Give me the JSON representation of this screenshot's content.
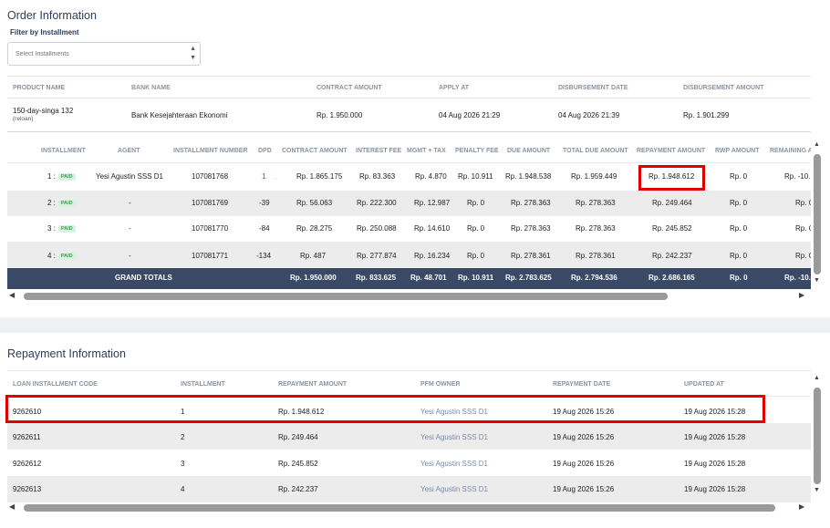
{
  "order": {
    "title": "Order Information",
    "filter_label": "Filter by Installment",
    "select_placeholder": "Select Installments",
    "headers": {
      "product_name": "PRODUCT NAME",
      "bank_name": "BANK NAME",
      "contract_amount": "CONTRACT AMOUNT",
      "apply_at": "APPLY AT",
      "disbursement_date": "DISBURSEMENT DATE",
      "disbursement_amount": "DISBURSEMENT AMOUNT"
    },
    "row": {
      "product_name": "150-day-singa 132",
      "product_sub": "(reloan)",
      "bank_name": "Bank Kesejahteraan Ekonomi",
      "contract_amount": "Rp. 1.950.000",
      "apply_at": "04 Aug 2026 21:29",
      "disbursement_date": "04 Aug 2026 21:39",
      "disbursement_amount": "Rp. 1.901.299"
    }
  },
  "installments": {
    "headers": {
      "installment": "INSTALLMENT",
      "agent": "AGENT",
      "installment_number": "INSTALLMENT NUMBER",
      "dpd": "DPD",
      "contract_amount": "CONTRACT AMOUNT",
      "interest_fee": "INTEREST FEE",
      "mgmt_tax": "MGMT + TAX",
      "penalty_fee": "PENALTY FEE",
      "due_amount": "DUE AMOUNT",
      "total_due_amount": "TOTAL DUE AMOUNT",
      "repayment_amount": "REPAYMENT AMOUNT",
      "rwp_amount": "RWP AMOUNT",
      "remaining": "REMAINING A"
    },
    "paid_label": "PAID",
    "rows": [
      {
        "installment": "1 :",
        "agent": "Yesi Agustin SSS D1",
        "number": "107081768",
        "dpd": "1",
        "contract": "Rp. 1.865.175",
        "interest": "Rp. 83.363",
        "mgmt": "Rp. 4.870",
        "penalty": "Rp. 10.911",
        "due": "Rp. 1.948.538",
        "total_due": "Rp. 1.959.449",
        "repayment": "Rp. 1.948.612",
        "rwp": "Rp. 0",
        "remaining": "Rp. -10."
      },
      {
        "installment": "2 :",
        "agent": "-",
        "number": "107081769",
        "dpd": "-39",
        "contract": "Rp. 56.063",
        "interest": "Rp. 222.300",
        "mgmt": "Rp. 12.987",
        "penalty": "Rp. 0",
        "due": "Rp. 278.363",
        "total_due": "Rp. 278.363",
        "repayment": "Rp. 249.464",
        "rwp": "Rp. 0",
        "remaining": "Rp. C"
      },
      {
        "installment": "3 :",
        "agent": "-",
        "number": "107081770",
        "dpd": "-84",
        "contract": "Rp. 28.275",
        "interest": "Rp. 250.088",
        "mgmt": "Rp. 14.610",
        "penalty": "Rp. 0",
        "due": "Rp. 278.363",
        "total_due": "Rp. 278.363",
        "repayment": "Rp. 245.852",
        "rwp": "Rp. 0",
        "remaining": "Rp. C"
      },
      {
        "installment": "4 :",
        "agent": "-",
        "number": "107081771",
        "dpd": "-134",
        "contract": "Rp. 487",
        "interest": "Rp. 277.874",
        "mgmt": "Rp. 16.234",
        "penalty": "Rp. 0",
        "due": "Rp. 278.361",
        "total_due": "Rp. 278.361",
        "repayment": "Rp. 242.237",
        "rwp": "Rp. 0",
        "remaining": "Rp. C"
      }
    ],
    "totals": {
      "label": "GRAND TOTALS",
      "contract": "Rp. 1.950.000",
      "interest": "Rp. 833.625",
      "mgmt": "Rp. 48.701",
      "penalty": "Rp. 10.911",
      "due": "Rp. 2.783.625",
      "total_due": "Rp. 2.794.536",
      "repayment": "Rp. 2.686.165",
      "rwp": "Rp. 0",
      "remaining": "Rp. -10."
    }
  },
  "repayment": {
    "title": "Repayment Information",
    "headers": {
      "code": "LOAN INSTALLMENT CODE",
      "installment": "INSTALLMENT",
      "amount": "REPAYMENT AMOUNT",
      "owner": "PFM OWNER",
      "date": "REPAYMENT DATE",
      "updated": "UPDATED AT"
    },
    "rows": [
      {
        "code": "9262610",
        "installment": "1",
        "amount": "Rp. 1.948.612",
        "owner": "Yesi Agustin SSS D1",
        "date": "19 Aug 2026 15:26",
        "updated": "19 Aug 2026 15:28"
      },
      {
        "code": "9262611",
        "installment": "2",
        "amount": "Rp. 249.464",
        "owner": "Yesi Agustin SSS D1",
        "date": "19 Aug 2026 15:26",
        "updated": "19 Aug 2026 15:28"
      },
      {
        "code": "9262612",
        "installment": "3",
        "amount": "Rp. 245.852",
        "owner": "Yesi Agustin SSS D1",
        "date": "19 Aug 2026 15:26",
        "updated": "19 Aug 2026 15:28"
      },
      {
        "code": "9262613",
        "installment": "4",
        "amount": "Rp. 242.237",
        "owner": "Yesi Agustin SSS D1",
        "date": "19 Aug 2026 15:26",
        "updated": "19 Aug 2026 15:28"
      }
    ]
  },
  "colors": {
    "highlight": "#e00000",
    "totals_bar": "#3a4a66",
    "paid_badge": "#3aa05a"
  }
}
